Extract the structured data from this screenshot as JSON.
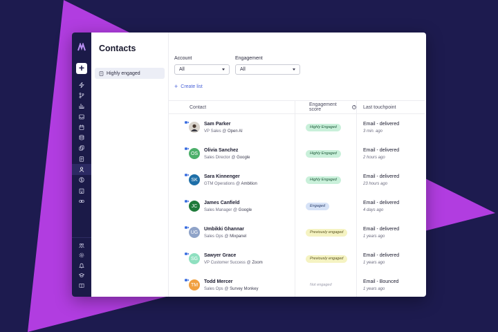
{
  "colors": {
    "background": "#1d1b4f",
    "triangle": "#b13de0",
    "rail": "#1b1a48",
    "accent_link": "#4a63d8"
  },
  "rail": {
    "logo_icon": "logo-icon",
    "add_label": "+",
    "nav_icons": [
      "lightning-icon",
      "branch-icon",
      "chart-icon",
      "inbox-icon",
      "calendar-icon",
      "database-icon",
      "copy-icon",
      "document-icon",
      "contacts-icon",
      "currency-icon",
      "building-icon",
      "link-icon"
    ],
    "active_icon": "contacts-icon",
    "bottom_icons": [
      "team-icon",
      "settings-icon",
      "bell-icon",
      "graduation-icon",
      "book-icon"
    ]
  },
  "lists": {
    "title": "Contacts",
    "items": [
      {
        "label": "Highly engaged",
        "icon": "list-icon"
      }
    ]
  },
  "filters": [
    {
      "label": "Account",
      "value": "All"
    },
    {
      "label": "Engagement",
      "value": "All"
    }
  ],
  "create_list": {
    "plus": "+",
    "label": "Create list"
  },
  "table": {
    "headers": {
      "contact": "Contact",
      "score": "Engagement score",
      "last": "Last touchpoint"
    },
    "rows": [
      {
        "name": "Sam Parker",
        "title": "VP Sales",
        "company": "Open AI",
        "initials": "",
        "avatar_color": "#e0ddd8",
        "photo": true,
        "score": "Highly Engaged",
        "score_kind": "he",
        "last": "Email - delivered",
        "ago": "3 min. ago"
      },
      {
        "name": "Olivia Sanchez",
        "title": "Sales Director",
        "company": "Google",
        "initials": "OS",
        "avatar_color": "#4caf6a",
        "photo": false,
        "score": "Highly Engaged",
        "score_kind": "he",
        "last": "Email - delivered",
        "ago": "2 hours ago"
      },
      {
        "name": "Sara Kinnenger",
        "title": "GTM Operations",
        "company": "Ambition",
        "initials": "SK",
        "avatar_color": "#1e6fa8",
        "photo": false,
        "score": "Highly Engaged",
        "score_kind": "he",
        "last": "Email - delivered",
        "ago": "23 hours ago"
      },
      {
        "name": "James Canfield",
        "title": "Sales Manager",
        "company": "Google",
        "initials": "JC",
        "avatar_color": "#1e7a3a",
        "photo": false,
        "score": "Engaged",
        "score_kind": "en",
        "last": "Email - delivered",
        "ago": "4 days ago"
      },
      {
        "name": "Umbikki Ghannar",
        "title": "Sales Ops",
        "company": "Mixpanel",
        "initials": "UG",
        "avatar_color": "#8fa3c8",
        "photo": false,
        "score": "Previously engaged",
        "score_kind": "pe",
        "last": "Email - delivered",
        "ago": "1 years ago"
      },
      {
        "name": "Sawyer Grace",
        "title": "VP Customer Success",
        "company": "Zoom",
        "initials": "SG",
        "avatar_color": "#8fe0c0",
        "photo": false,
        "score": "Previously engaged",
        "score_kind": "pe",
        "last": "Email - delivered",
        "ago": "1 years ago"
      },
      {
        "name": "Todd Mercer",
        "title": "Sales Ops",
        "company": "Survey Monkey",
        "initials": "TM",
        "avatar_color": "#f0a040",
        "photo": false,
        "score": "Not engaged",
        "score_kind": "ne",
        "last": "Email - Bounced",
        "ago": "1 years ago"
      }
    ],
    "role_separator": " @ "
  }
}
